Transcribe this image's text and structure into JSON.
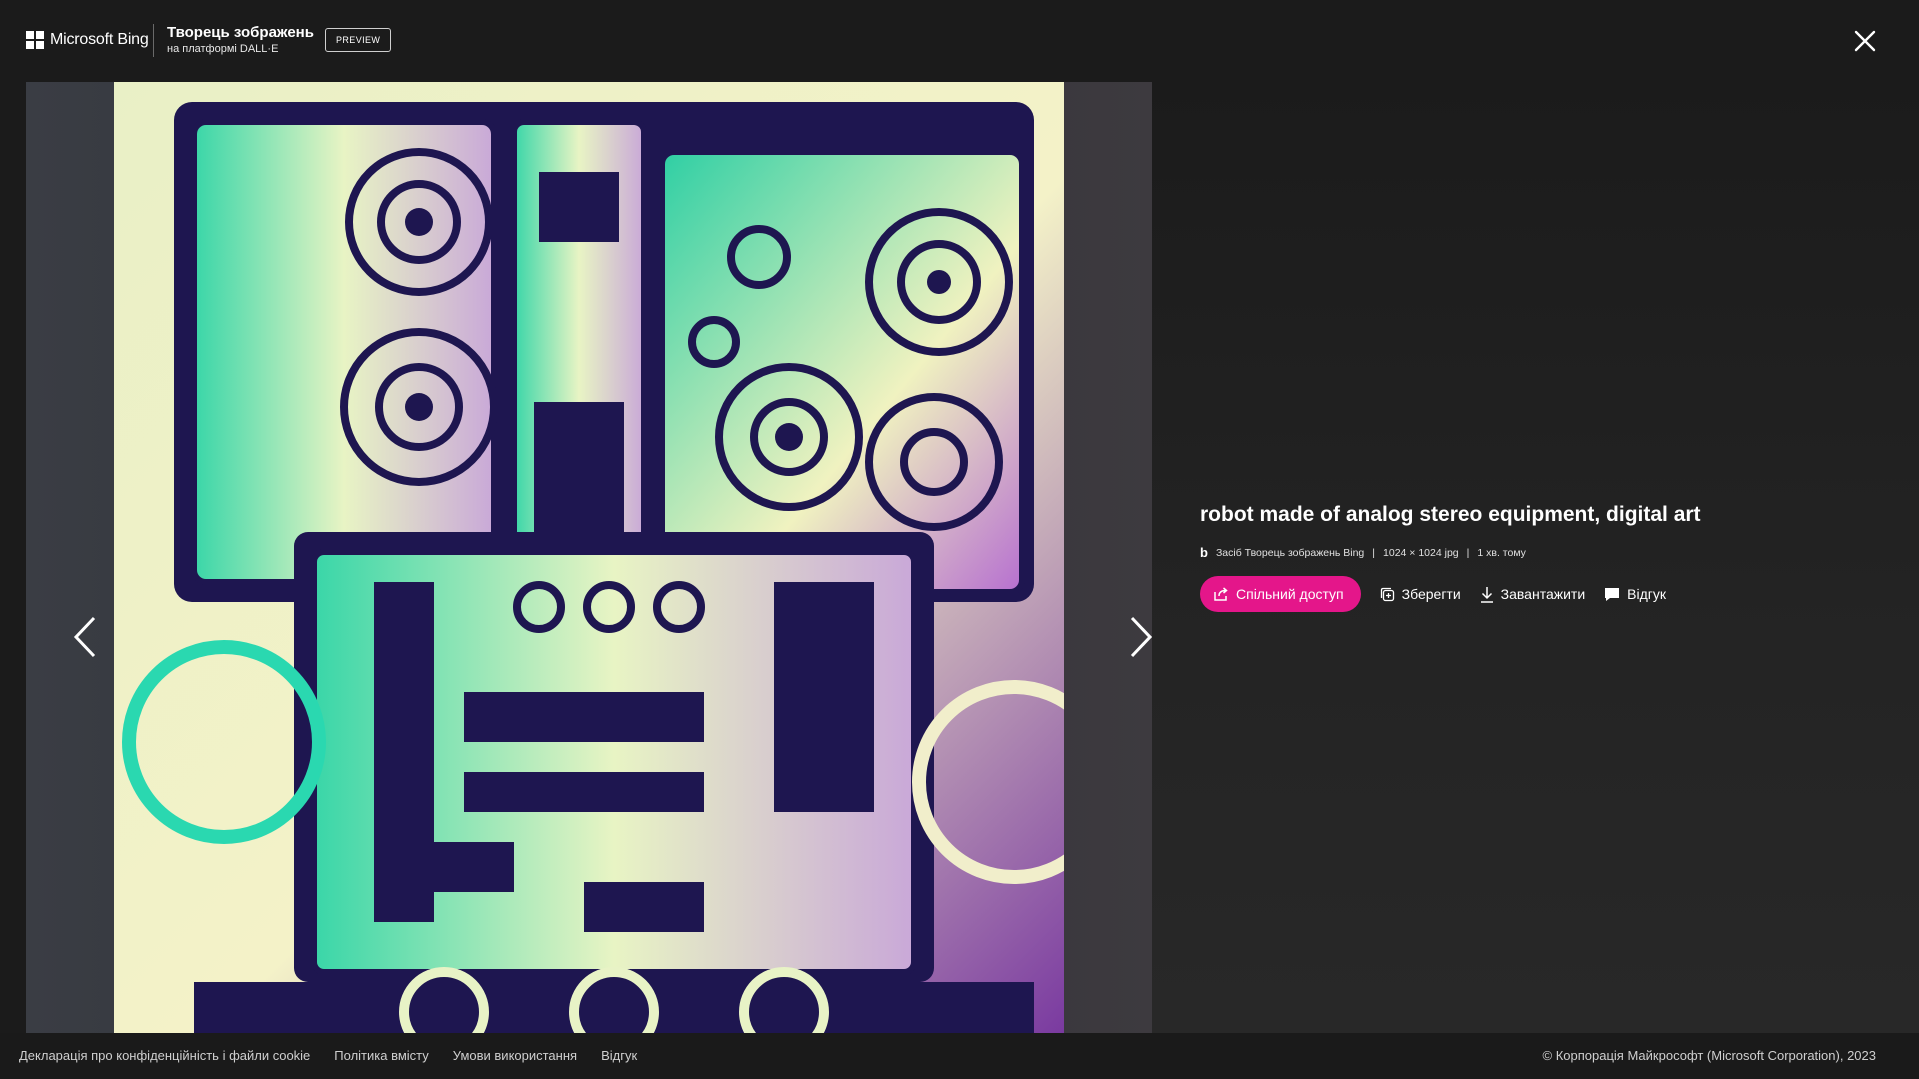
{
  "header": {
    "brand_name": "Microsoft Bing",
    "product_title": "Творець зображень",
    "product_subtitle": "на платформі DALL·E",
    "badge": "PREVIEW",
    "close_icon": "close-icon"
  },
  "image": {
    "title": "robot made of analog stereo equipment, digital art",
    "source": "Засіб Творець зображень Bing",
    "dimensions": "1024 × 1024 jpg",
    "time": "1 хв. тому",
    "separator": "|"
  },
  "actions": {
    "share": "Спільний доступ",
    "save": "Зберегти",
    "download": "Завантажити",
    "feedback": "Відгук"
  },
  "footer": {
    "links": [
      "Декларація про конфіденційність і файли cookie",
      "Політика вмісту",
      "Умови використання",
      "Відгук"
    ],
    "copyright": "© Корпорація Майкрософт (Microsoft Corporation), 2023"
  },
  "colors": {
    "accent": "#e4168a",
    "background": "#1b1b1b"
  }
}
